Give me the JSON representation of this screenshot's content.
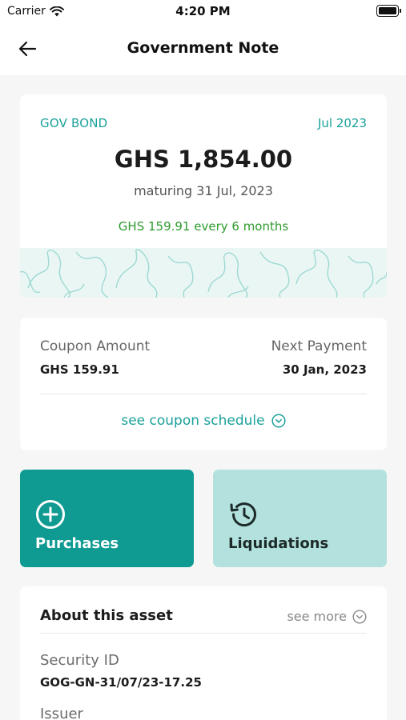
{
  "status_bar": {
    "carrier": "Carrier",
    "time": "4:20 PM"
  },
  "nav": {
    "title": "Government Note",
    "back_icon": "back-arrow-icon"
  },
  "bond": {
    "type": "GOV BOND",
    "date": "Jul 2023",
    "amount": "GHS 1,854.00",
    "maturing": "maturing 31 Jul, 2023",
    "coupon_line": "GHS 159.91 every 6 months"
  },
  "coupon": {
    "amount_label": "Coupon Amount",
    "amount_value": "GHS 159.91",
    "next_label": "Next Payment",
    "next_value": "30 Jan, 2023",
    "schedule_link": "see coupon schedule"
  },
  "actions": {
    "purchases": {
      "label": "Purchases",
      "icon": "plus-circle-icon"
    },
    "liquidations": {
      "label": "Liquidations",
      "icon": "history-icon"
    }
  },
  "about": {
    "title": "About this asset",
    "see_more": "see more",
    "security_id_label": "Security ID",
    "security_id_value": "GOG-GN-31/07/23-17.25",
    "issuer_label": "Issuer"
  },
  "colors": {
    "accent": "#1aa19a",
    "purchase_tile": "#0f9a92",
    "liquidation_tile": "#b2e1de",
    "coupon_text": "#2d9a2d"
  }
}
